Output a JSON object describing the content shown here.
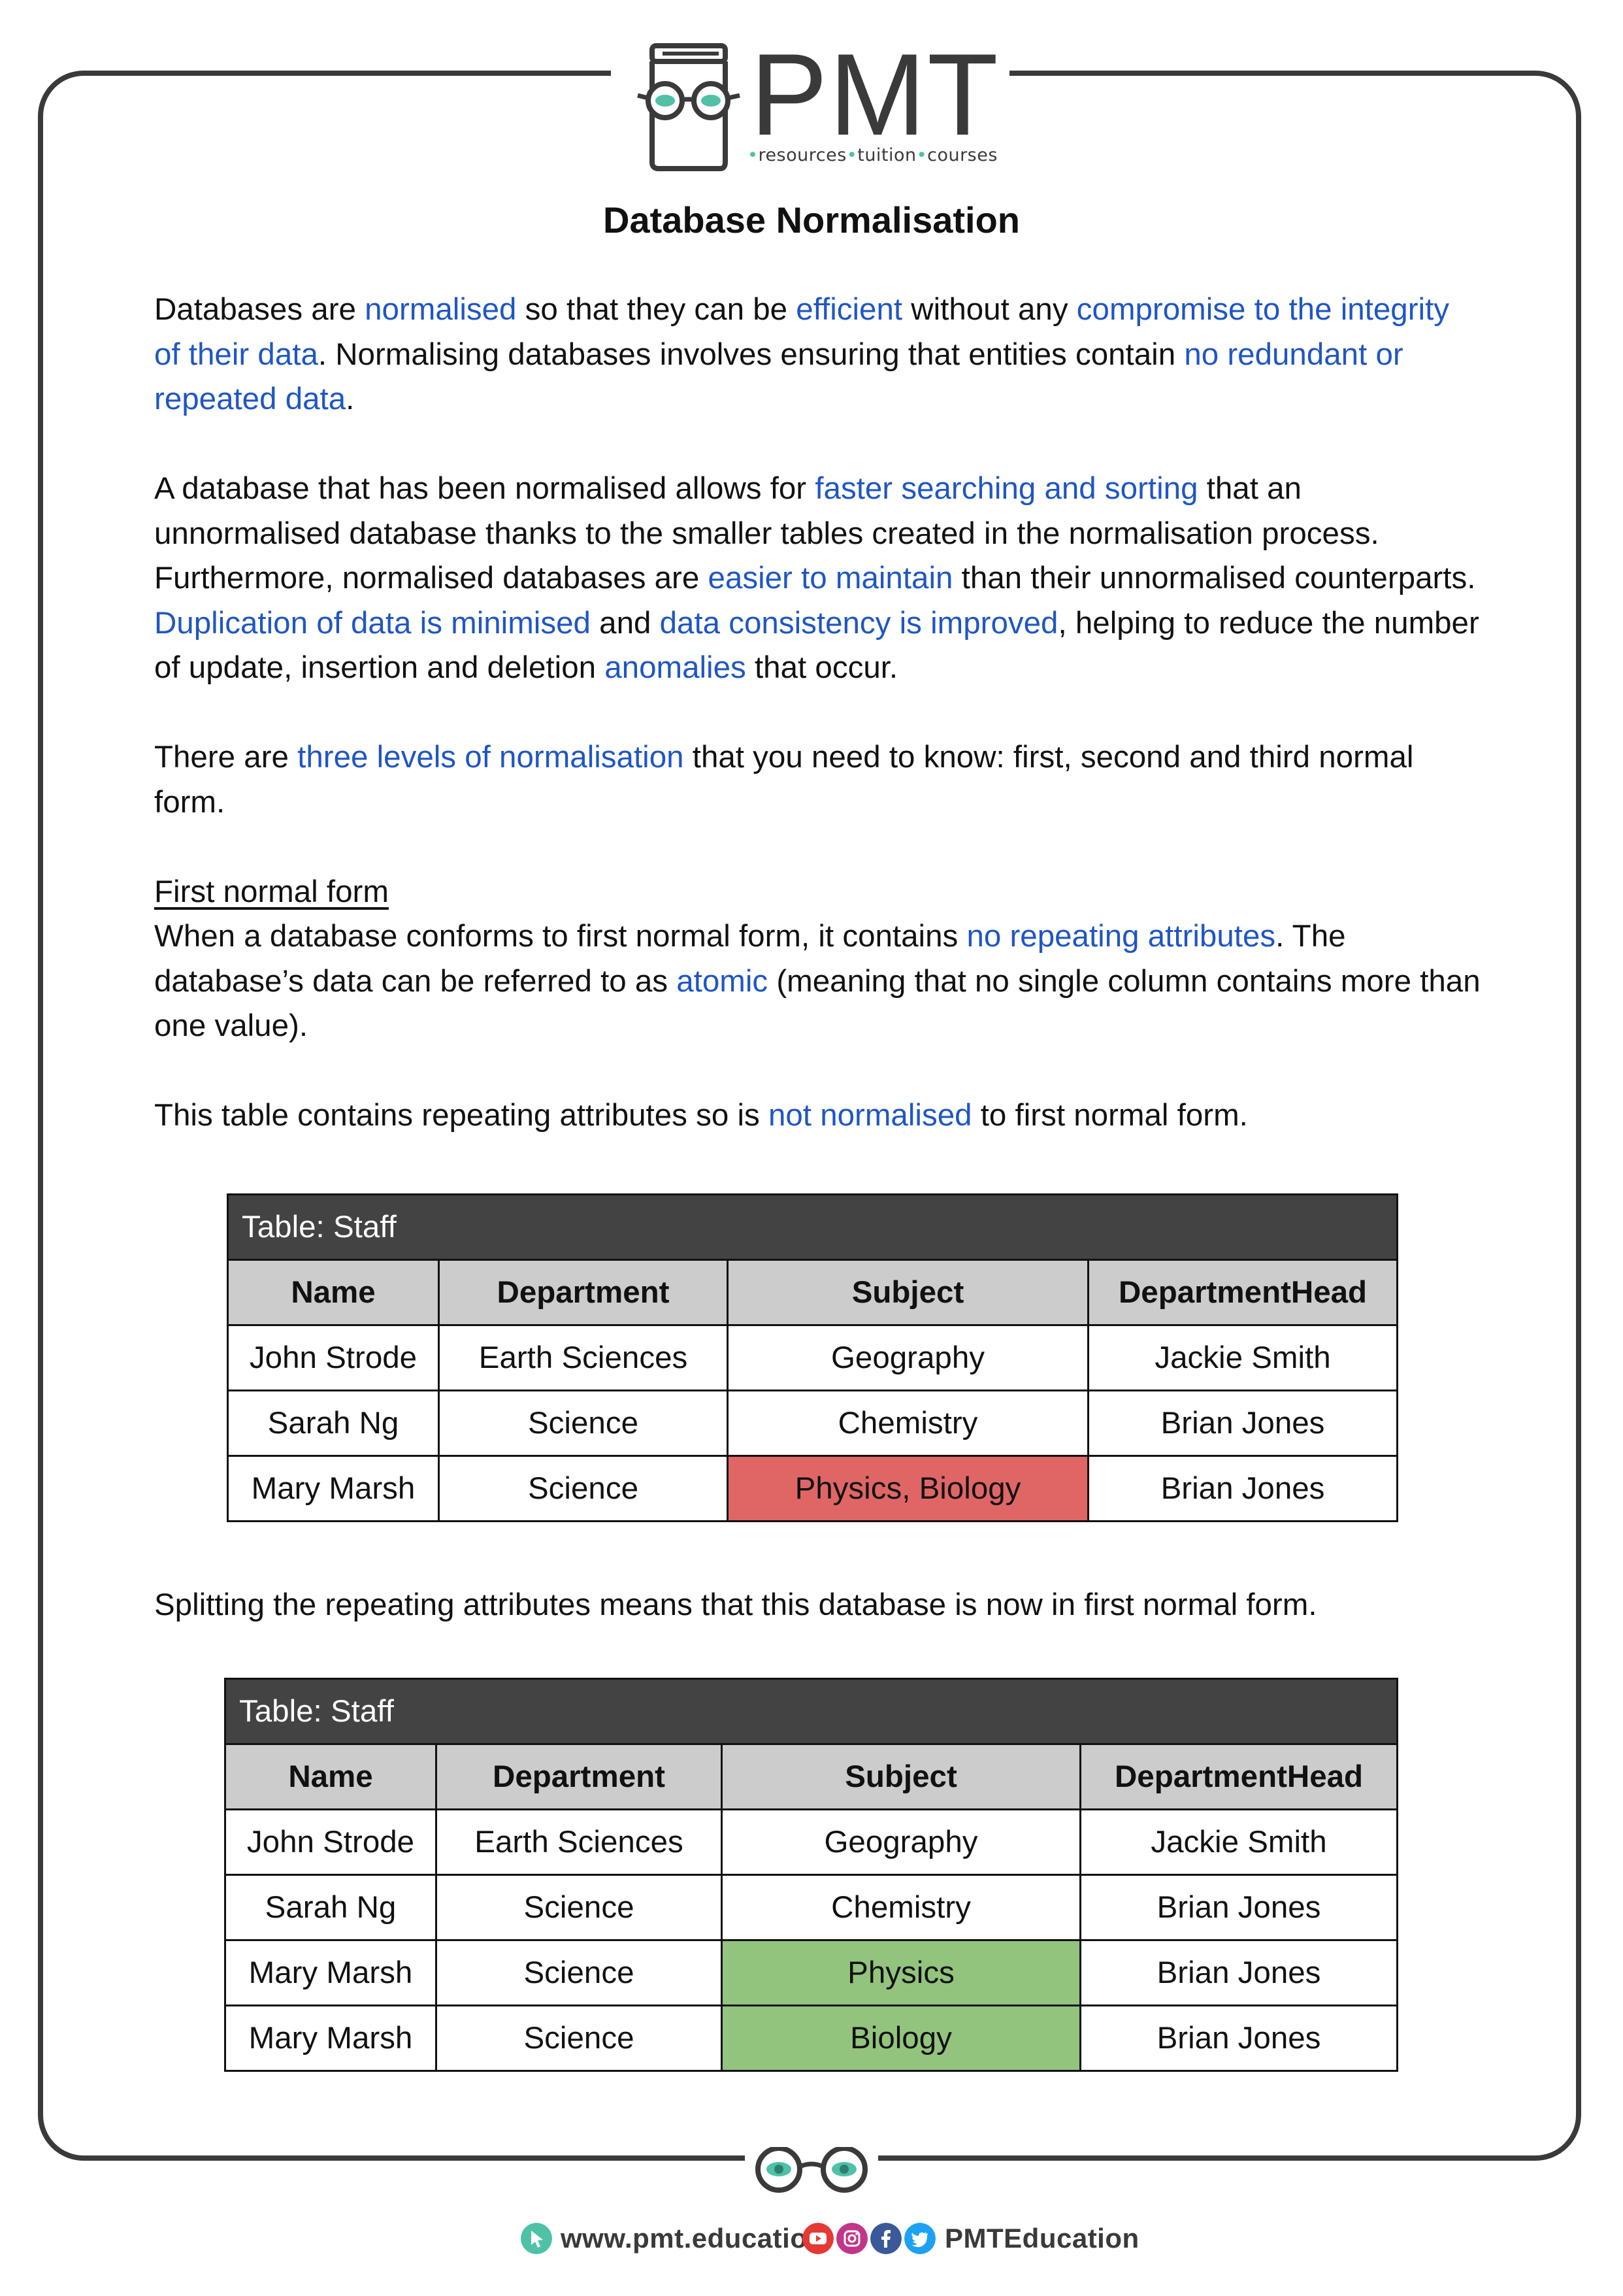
{
  "logo": {
    "text": "PMT",
    "tagline_1": "resources",
    "tagline_2": "tuition",
    "tagline_3": "courses",
    "accent": "#4fc1a7"
  },
  "title": "Database Normalisation",
  "paragraphs": {
    "p1": [
      "Databases are ",
      "normalised",
      " so that they can be ",
      "efficient",
      " without any ",
      "compromise to the integrity of their data",
      ". Normalising databases involves ensuring that entities contain ",
      "no redundant or repeated data",
      "."
    ],
    "p2": [
      "A database that has been normalised allows for ",
      "faster searching and sorting",
      " that an unnormalised database thanks to the smaller tables created in the normalisation process. Furthermore, normalised databases are ",
      "easier to maintain",
      " than their unnormalised counterparts. ",
      "Duplication of data is minimised",
      " and ",
      "data consistency is improved",
      ", helping to reduce the number of update, insertion and deletion ",
      "anomalies",
      " that occur."
    ],
    "p3": [
      "There are ",
      "three levels of normalisation",
      " that you need to know: first, second and third normal form."
    ],
    "subheading": "First normal form",
    "p4": [
      "When a database conforms to first normal form, it contains ",
      "no repeating attributes",
      ". The database’s data can be referred to as ",
      "atomic",
      " (meaning that no single column contains more than one value)."
    ],
    "p5": [
      "This table contains repeating attributes so is ",
      "not normalised",
      " to first normal form."
    ],
    "p6": "Splitting the repeating attributes means that this database is now in first normal form."
  },
  "table1": {
    "caption": "Table: Staff",
    "headers": [
      "Name",
      "Department",
      "Subject",
      "DepartmentHead"
    ],
    "rows": [
      [
        "John Strode",
        "Earth Sciences",
        "Geography",
        "Jackie Smith"
      ],
      [
        "Sarah Ng",
        "Science",
        "Chemistry",
        "Brian Jones"
      ],
      [
        "Mary Marsh",
        "Science",
        "Physics, Biology",
        "Brian Jones"
      ]
    ],
    "highlight_color": "#e06666"
  },
  "table2": {
    "caption": "Table: Staff",
    "headers": [
      "Name",
      "Department",
      "Subject",
      "DepartmentHead"
    ],
    "rows": [
      [
        "John Strode",
        "Earth Sciences",
        "Geography",
        "Jackie Smith"
      ],
      [
        "Sarah Ng",
        "Science",
        "Chemistry",
        "Brian Jones"
      ],
      [
        "Mary Marsh",
        "Science",
        "Physics",
        "Brian Jones"
      ],
      [
        "Mary Marsh",
        "Science",
        "Biology",
        "Brian Jones"
      ]
    ],
    "highlight_color": "#93c47d"
  },
  "footer": {
    "website": "www.pmt.education",
    "handle": "PMTEducation"
  },
  "colors": {
    "highlight_text": "#1f56c4",
    "frame": "#3a3a3a"
  }
}
